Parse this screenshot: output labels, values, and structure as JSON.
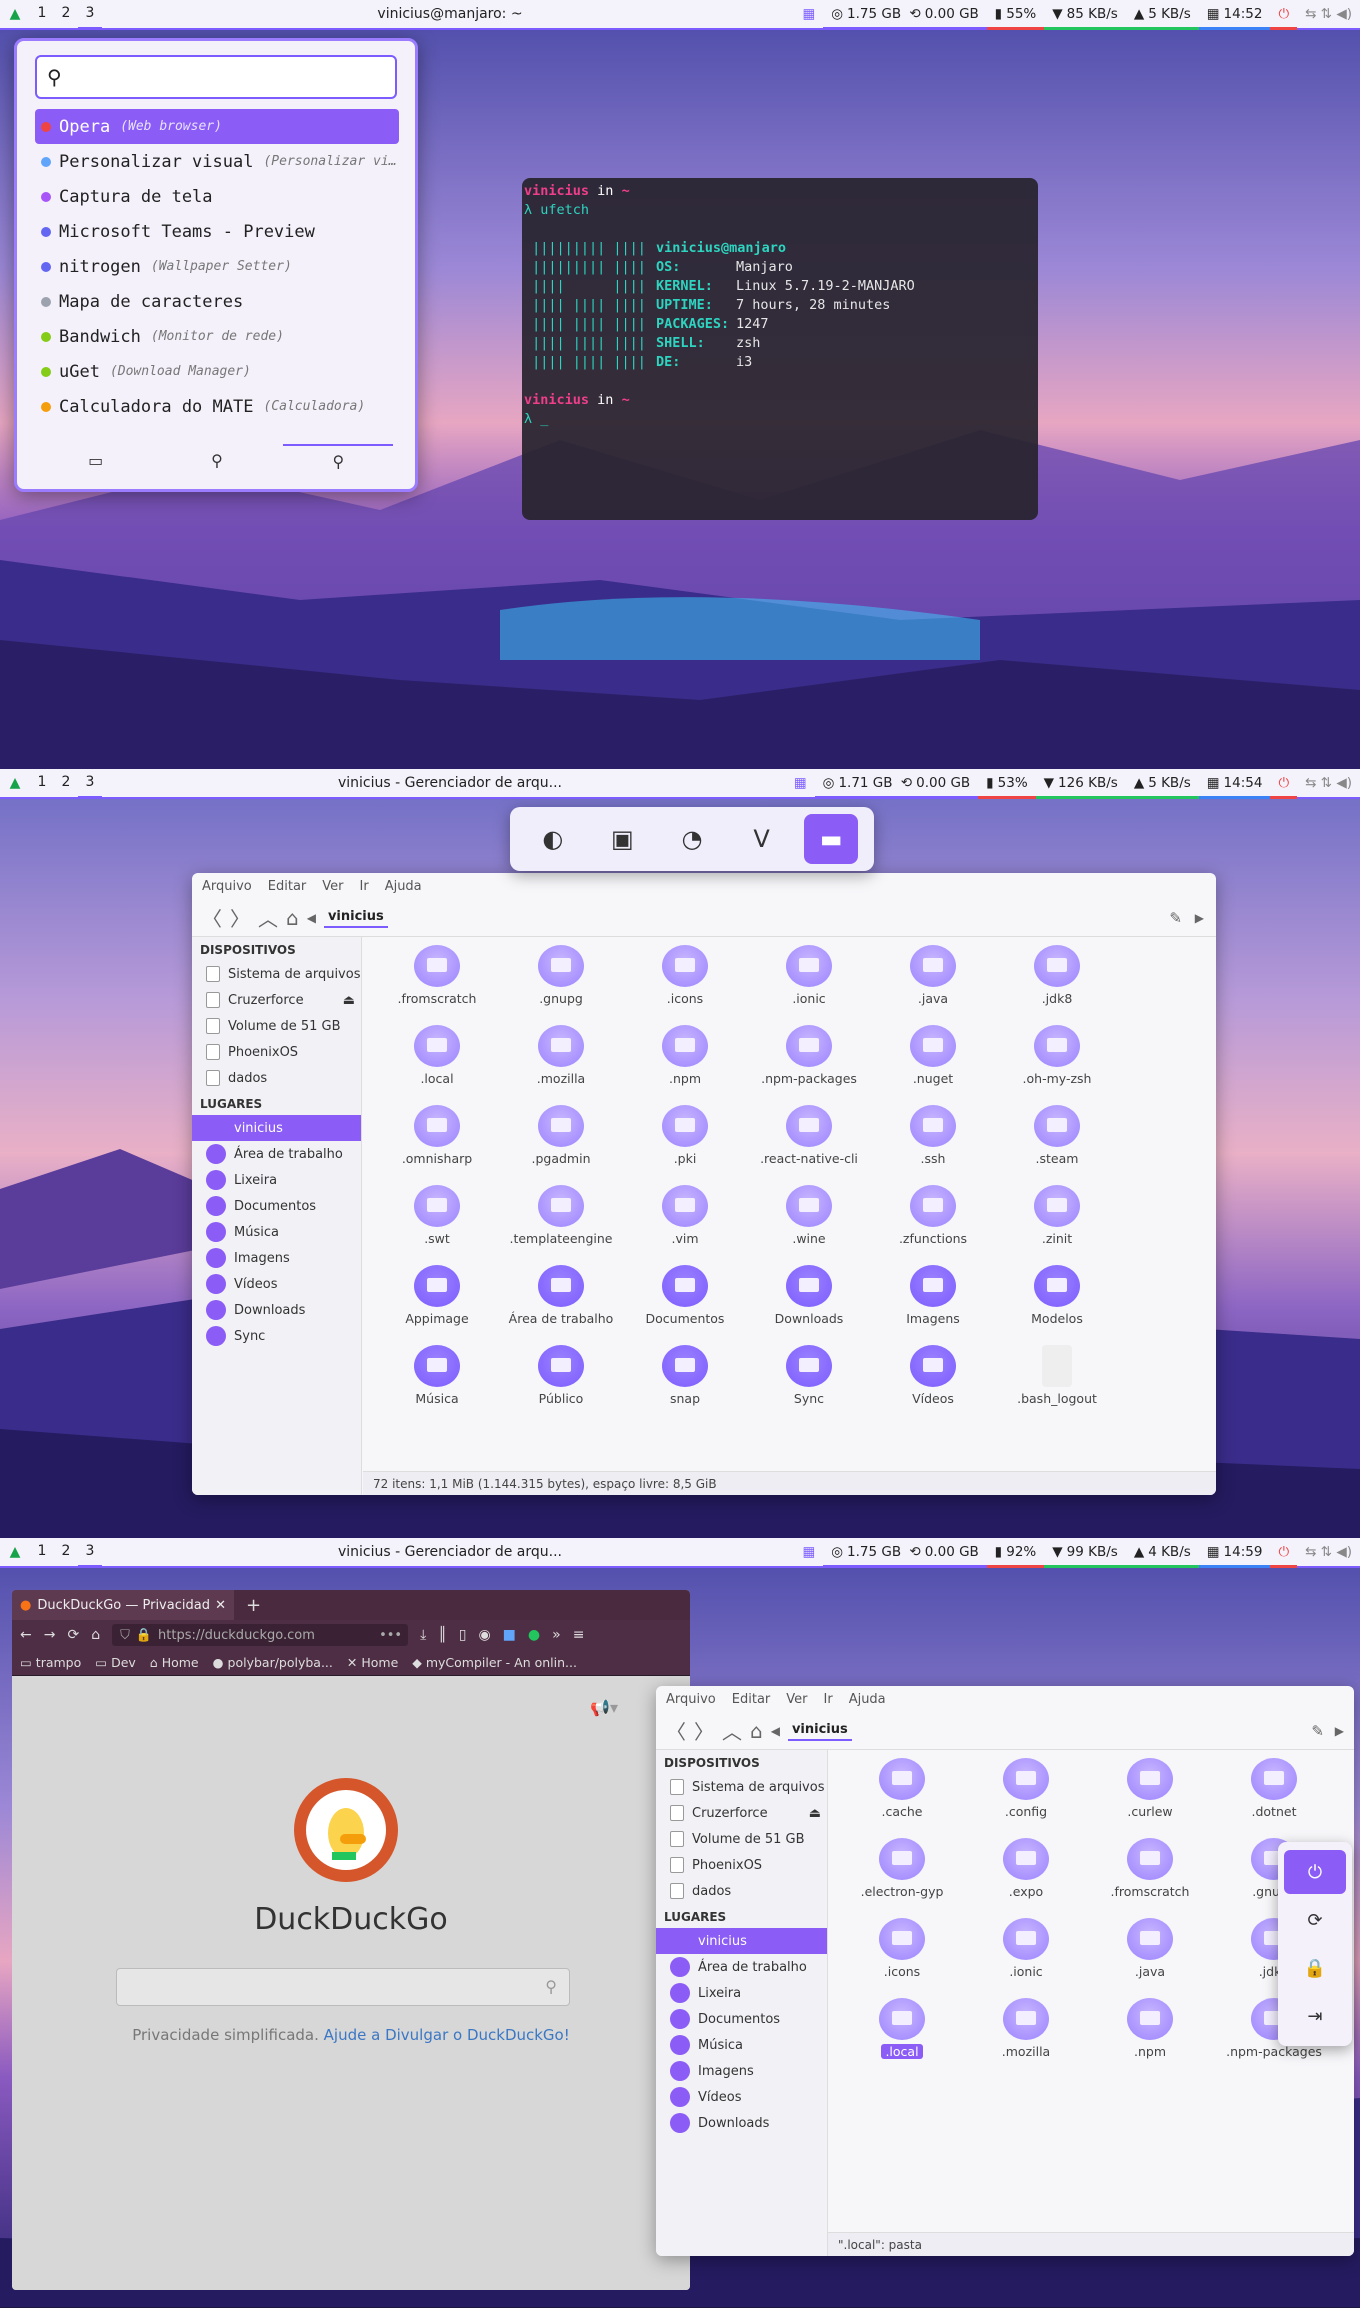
{
  "screens": [
    {
      "bar": {
        "logo": "▲",
        "workspaces": [
          "1",
          "2",
          "3"
        ],
        "title": "vinicius@manjaro: ~",
        "grid_icon": "▦",
        "mem": "1.75 GB",
        "swap": "0.00 GB",
        "battery": "55%",
        "down": "85 KB/s",
        "up": "5 KB/s",
        "clock": "14:52",
        "power": "⏻"
      },
      "launcher": {
        "items": [
          {
            "name": "Opera",
            "sub": "(Web browser)",
            "color": "#ef4444"
          },
          {
            "name": "Personalizar visual",
            "sub": "(Personalizar vi…",
            "color": "#60a5fa"
          },
          {
            "name": "Captura de tela",
            "sub": "",
            "color": "#a855f7"
          },
          {
            "name": "Microsoft Teams - Preview",
            "sub": "",
            "color": "#6366f1"
          },
          {
            "name": "nitrogen",
            "sub": "(Wallpaper Setter)",
            "color": "#6366f1"
          },
          {
            "name": "Mapa de caracteres",
            "sub": "",
            "color": "#9ca3af"
          },
          {
            "name": "Bandwich",
            "sub": "(Monitor de rede)",
            "color": "#84cc16"
          },
          {
            "name": "uGet",
            "sub": "(Download Manager)",
            "color": "#84cc16"
          },
          {
            "name": "Calculadora do MATE",
            "sub": "(Calculadora)",
            "color": "#f59e0b"
          }
        ]
      },
      "terminal": {
        "user": "vinicius",
        "in": "in",
        "dir": "~",
        "cmd": "ufetch",
        "host": "vinicius@manjaro",
        "logo": [
          " ||||||||| ||||",
          " ||||||||| ||||",
          " ||||      ||||",
          " |||| |||| ||||",
          " |||| |||| ||||",
          " |||| |||| ||||",
          " |||| |||| ||||"
        ],
        "info": [
          {
            "k": "",
            "v": ""
          },
          {
            "k": "OS:",
            "v": "Manjaro"
          },
          {
            "k": "KERNEL:",
            "v": "Linux 5.7.19-2-MANJARO"
          },
          {
            "k": "UPTIME:",
            "v": "7 hours, 28 minutes"
          },
          {
            "k": "PACKAGES:",
            "v": "1247"
          },
          {
            "k": "SHELL:",
            "v": "zsh"
          },
          {
            "k": "DE:",
            "v": "i3"
          }
        ],
        "prompt": "λ _"
      }
    },
    {
      "bar": {
        "logo": "▲",
        "workspaces": [
          "1",
          "2",
          "3"
        ],
        "title": "vinicius - Gerenciador de arqu...",
        "grid_icon": "▦",
        "mem": "1.71 GB",
        "swap": "0.00 GB",
        "battery": "53%",
        "down": "126 KB/s",
        "up": "5 KB/s",
        "clock": "14:54",
        "power": "⏻"
      },
      "fm": {
        "menu": [
          "Arquivo",
          "Editar",
          "Ver",
          "Ir",
          "Ajuda"
        ],
        "path": "vinicius",
        "devices_title": "DISPOSITIVOS",
        "devices": [
          "Sistema de arquivos",
          "Cruzerforce",
          "Volume de 51 GB",
          "PhoenixOS",
          "dados"
        ],
        "places_title": "LUGARES",
        "places": [
          "vinicius",
          "Área de trabalho",
          "Lixeira",
          "Documentos",
          "Música",
          "Imagens",
          "Vídeos",
          "Downloads",
          "Sync"
        ],
        "files": [
          ".fromscratch",
          ".gnupg",
          ".icons",
          ".ionic",
          ".java",
          ".jdk8",
          ".local",
          ".mozilla",
          ".npm",
          ".npm-packages",
          ".nuget",
          ".oh-my-zsh",
          ".omnisharp",
          ".pgadmin",
          ".pki",
          ".react-native-cli",
          ".ssh",
          ".steam",
          ".swt",
          ".templateengine",
          ".vim",
          ".wine",
          ".zfunctions",
          ".zinit",
          "Appimage",
          "Área de trabalho",
          "Documentos",
          "Downloads",
          "Imagens",
          "Modelos",
          "Música",
          "Público",
          "snap",
          "Sync",
          "Vídeos",
          ".bash_logout"
        ],
        "status": "72 itens: 1,1 MiB (1.144.315 bytes), espaço livre: 8,5 GiB"
      }
    },
    {
      "bar": {
        "logo": "▲",
        "workspaces": [
          "1",
          "2",
          "3"
        ],
        "title": "vinicius - Gerenciador de arqu...",
        "grid_icon": "▦",
        "mem": "1.75 GB",
        "swap": "0.00 GB",
        "battery": "92%",
        "down": "99 KB/s",
        "up": "4 KB/s",
        "clock": "14:59",
        "power": "⏻"
      },
      "browser": {
        "tab": "DuckDuckGo — Privacidade",
        "url": "https://duckduckgo.com",
        "bookmarks": [
          "trampo",
          "Dev",
          "Home",
          "polybar/polyba...",
          "Home",
          "myCompiler - An onlin..."
        ],
        "name": "DuckDuckGo",
        "tagline": "Privacidade simplificada.",
        "link": "Ajude a Divulgar o DuckDuckGo!"
      },
      "fm": {
        "menu": [
          "Arquivo",
          "Editar",
          "Ver",
          "Ir",
          "Ajuda"
        ],
        "path": "vinicius",
        "devices_title": "DISPOSITIVOS",
        "devices": [
          "Sistema de arquivos",
          "Cruzerforce",
          "Volume de 51 GB",
          "PhoenixOS",
          "dados"
        ],
        "places_title": "LUGARES",
        "places": [
          "vinicius",
          "Área de trabalho",
          "Lixeira",
          "Documentos",
          "Música",
          "Imagens",
          "Vídeos",
          "Downloads"
        ],
        "files": [
          ".cache",
          ".config",
          ".curlew",
          ".dotnet",
          ".electron-gyp",
          ".expo",
          ".fromscratch",
          ".gnupg",
          ".icons",
          ".ionic",
          ".java",
          ".jdk8",
          ".local",
          ".mozilla",
          ".npm",
          ".npm-packages"
        ],
        "status": "\".local\": pasta"
      },
      "power_menu": [
        "⏻",
        "⟳",
        "🔒",
        "⇥"
      ]
    }
  ]
}
